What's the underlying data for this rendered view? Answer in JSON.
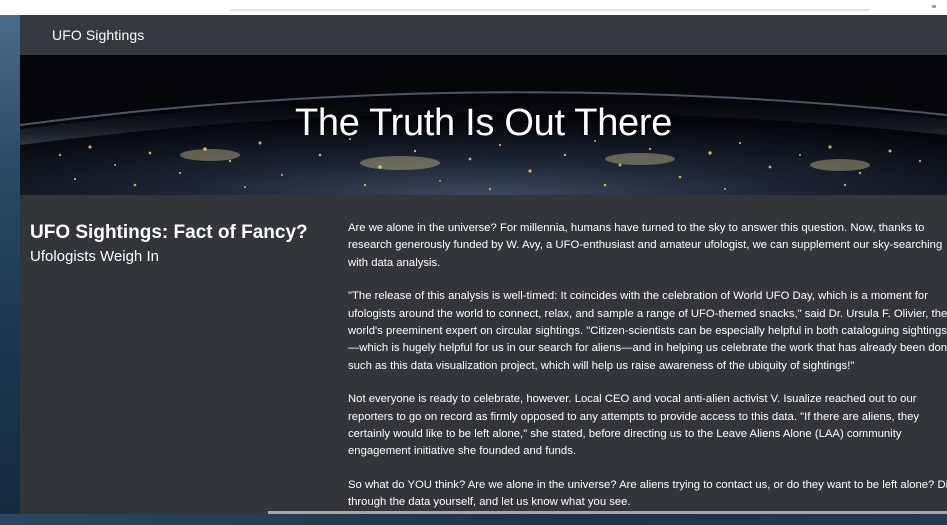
{
  "navbar": {
    "brand": "UFO Sightings"
  },
  "hero": {
    "title": "The Truth Is Out There"
  },
  "sidebar": {
    "heading": "UFO Sightings: Fact of Fancy?",
    "subheading": "Ufologists Weigh In"
  },
  "article": {
    "paragraphs": [
      [
        "Are we alone in the universe? For millennia, humans have turned to the sky to answer this question. Now, thanks to",
        "research generously funded by W. Avy, a UFO-enthusiast and amateur ufologist, we can supplement our sky-searching",
        "with data analysis."
      ],
      [
        "\"The release of this analysis is well-timed: It coincides with the celebration of World UFO Day, which is a moment for",
        "ufologists around the world to connect, relax, and sample a range of UFO-themed snacks,\" said Dr. Ursula F. Olivier, the",
        "world's preeminent expert on circular sightings. \"Citizen-scientists can be especially helpful in both cataloguing sightings",
        "—which is hugely helpful for us in our search for aliens—and in helping us celebrate the work that has already been done,",
        "such as this data visualization project, which will help us raise awareness of the ubiquity of sightings!\""
      ],
      [
        "Not everyone is ready to celebrate, however. Local CEO and vocal anti-alien activist V. Isualize reached out to our",
        "reporters to go on record as firmly opposed to any attempts to provide access to this data. \"If there are aliens, they",
        "certainly would like to be left alone,\" she stated, before directing us to the Leave Aliens Alone (LAA) community",
        "engagement initiative she founded and funds."
      ],
      [
        "So what do YOU think? Are we alone in the universe? Are aliens trying to contact us, or do they want to be left alone? Dig",
        "through the data yourself, and let us know what you see."
      ]
    ]
  }
}
